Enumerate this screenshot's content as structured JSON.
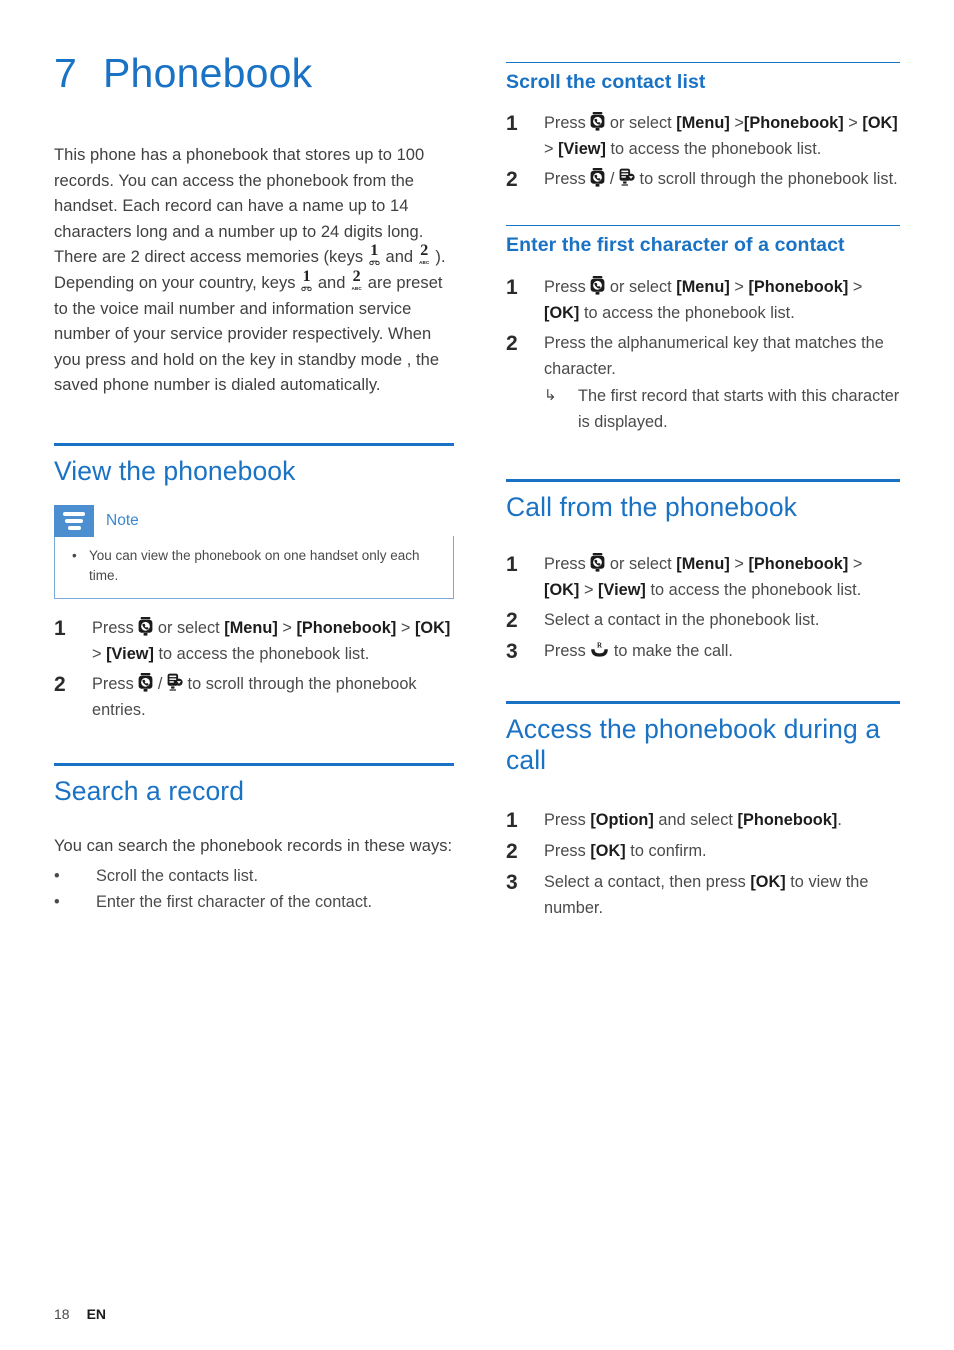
{
  "chapter": {
    "number": "7",
    "title": "Phonebook"
  },
  "intro": {
    "part1": "This phone has a phonebook that stores up to 100 records. You can access the phonebook from the handset. Each record can have a name up to 14 characters long and a number up to 24 digits long.",
    "part2_a": "There are 2 direct access memories (keys ",
    "part2_b": " and ",
    "part2_c": " ). Depending on your country, keys ",
    "part2_d": " and ",
    "part2_e": " are preset to the voice mail number and information service number of your service provider respectively. When you press and hold on the key in standby mode , the saved phone number is dialed automatically."
  },
  "icons": {
    "phonebook_key": "phonebook-key-icon",
    "down_key": "scroll-down-key-icon",
    "talk_key": "talk-key-icon",
    "key_one": "key-1-voicemail-icon",
    "key_two": "key-2-abc-icon",
    "note_badge": "note-icon",
    "substep_arrow": "substep-arrow-icon"
  },
  "sections": {
    "view_phonebook": {
      "heading": "View the phonebook",
      "note": {
        "title": "Note",
        "items": [
          "You can view the phonebook on one handset only each time."
        ]
      },
      "steps": [
        {
          "num": "1",
          "segments": [
            {
              "t": "Press ",
              "b": false
            },
            {
              "icon": "phonebook_key"
            },
            {
              "t": " or select ",
              "b": false
            },
            {
              "t": "[Menu]",
              "b": true
            },
            {
              "t": " > ",
              "b": false
            },
            {
              "t": "[Phonebook]",
              "b": true
            },
            {
              "t": " > ",
              "b": false
            },
            {
              "t": "[OK]",
              "b": true
            },
            {
              "t": " > ",
              "b": false
            },
            {
              "t": "[View]",
              "b": true
            },
            {
              "t": " to access the phonebook list.",
              "b": false
            }
          ]
        },
        {
          "num": "2",
          "segments": [
            {
              "t": "Press ",
              "b": false
            },
            {
              "icon": "phonebook_key"
            },
            {
              "t": " / ",
              "b": false
            },
            {
              "icon": "down_key"
            },
            {
              "t": " to scroll through the phonebook entries.",
              "b": false
            }
          ]
        }
      ]
    },
    "search_record": {
      "heading": "Search a record",
      "intro": "You can search the phonebook records in these ways:",
      "bullets": [
        "Scroll the contacts list.",
        "Enter the first character of the contact."
      ],
      "subsections": [
        {
          "heading": "Scroll the contact list",
          "steps": [
            {
              "num": "1",
              "segments": [
                {
                  "t": "Press ",
                  "b": false
                },
                {
                  "icon": "phonebook_key"
                },
                {
                  "t": " or select ",
                  "b": false
                },
                {
                  "t": "[Menu]",
                  "b": true
                },
                {
                  "t": " >",
                  "b": false
                },
                {
                  "t": "[Phonebook]",
                  "b": true
                },
                {
                  "t": " > ",
                  "b": false
                },
                {
                  "t": "[OK]",
                  "b": true
                },
                {
                  "t": " > ",
                  "b": false
                },
                {
                  "t": "[View]",
                  "b": true
                },
                {
                  "t": " to access the phonebook list.",
                  "b": false
                }
              ]
            },
            {
              "num": "2",
              "segments": [
                {
                  "t": "Press ",
                  "b": false
                },
                {
                  "icon": "phonebook_key"
                },
                {
                  "t": " / ",
                  "b": false
                },
                {
                  "icon": "down_key"
                },
                {
                  "t": " to scroll through the phonebook list.",
                  "b": false
                }
              ]
            }
          ]
        },
        {
          "heading": "Enter the first character of a contact",
          "steps": [
            {
              "num": "1",
              "segments": [
                {
                  "t": "Press ",
                  "b": false
                },
                {
                  "icon": "phonebook_key"
                },
                {
                  "t": " or select ",
                  "b": false
                },
                {
                  "t": "[Menu]",
                  "b": true
                },
                {
                  "t": " > ",
                  "b": false
                },
                {
                  "t": "[Phonebook]",
                  "b": true
                },
                {
                  "t": " > ",
                  "b": false
                },
                {
                  "t": "[OK]",
                  "b": true
                },
                {
                  "t": " to access the phonebook list.",
                  "b": false
                }
              ]
            },
            {
              "num": "2",
              "segments": [
                {
                  "t": "Press the alphanumerical key that matches the character.",
                  "b": false
                }
              ],
              "substeps": [
                "The first record that starts with this character is displayed."
              ]
            }
          ]
        }
      ]
    },
    "call_from_phonebook": {
      "heading": "Call from the phonebook",
      "steps": [
        {
          "num": "1",
          "segments": [
            {
              "t": "Press ",
              "b": false
            },
            {
              "icon": "phonebook_key"
            },
            {
              "t": " or select ",
              "b": false
            },
            {
              "t": "[Menu]",
              "b": true
            },
            {
              "t": " > ",
              "b": false
            },
            {
              "t": "[Phonebook]",
              "b": true
            },
            {
              "t": " > ",
              "b": false
            },
            {
              "t": "[OK]",
              "b": true
            },
            {
              "t": " > ",
              "b": false
            },
            {
              "t": "[View]",
              "b": true
            },
            {
              "t": " to access the phonebook list.",
              "b": false
            }
          ]
        },
        {
          "num": "2",
          "segments": [
            {
              "t": "Select a contact in the phonebook list.",
              "b": false
            }
          ]
        },
        {
          "num": "3",
          "segments": [
            {
              "t": "Press ",
              "b": false
            },
            {
              "icon": "talk_key"
            },
            {
              "t": " to make the call.",
              "b": false
            }
          ]
        }
      ]
    },
    "access_during_call": {
      "heading": "Access the phonebook during a call",
      "steps": [
        {
          "num": "1",
          "segments": [
            {
              "t": "Press ",
              "b": false
            },
            {
              "t": "[Option]",
              "b": true
            },
            {
              "t": " and select ",
              "b": false
            },
            {
              "t": "[Phonebook]",
              "b": true
            },
            {
              "t": ".",
              "b": false
            }
          ]
        },
        {
          "num": "2",
          "segments": [
            {
              "t": "Press ",
              "b": false
            },
            {
              "t": "[OK]",
              "b": true
            },
            {
              "t": " to confirm.",
              "b": false
            }
          ]
        },
        {
          "num": "3",
          "segments": [
            {
              "t": "Select a contact, then press ",
              "b": false
            },
            {
              "t": "[OK]",
              "b": true
            },
            {
              "t": " to view the number.",
              "b": false
            }
          ]
        }
      ]
    }
  },
  "footer": {
    "page_number": "18",
    "language": "EN"
  },
  "colors": {
    "accent_blue": "#1a72c4",
    "note_badge_blue": "#4b8fd1",
    "note_border_blue": "#7aa9d8",
    "body_text": "#4a4a4a"
  }
}
